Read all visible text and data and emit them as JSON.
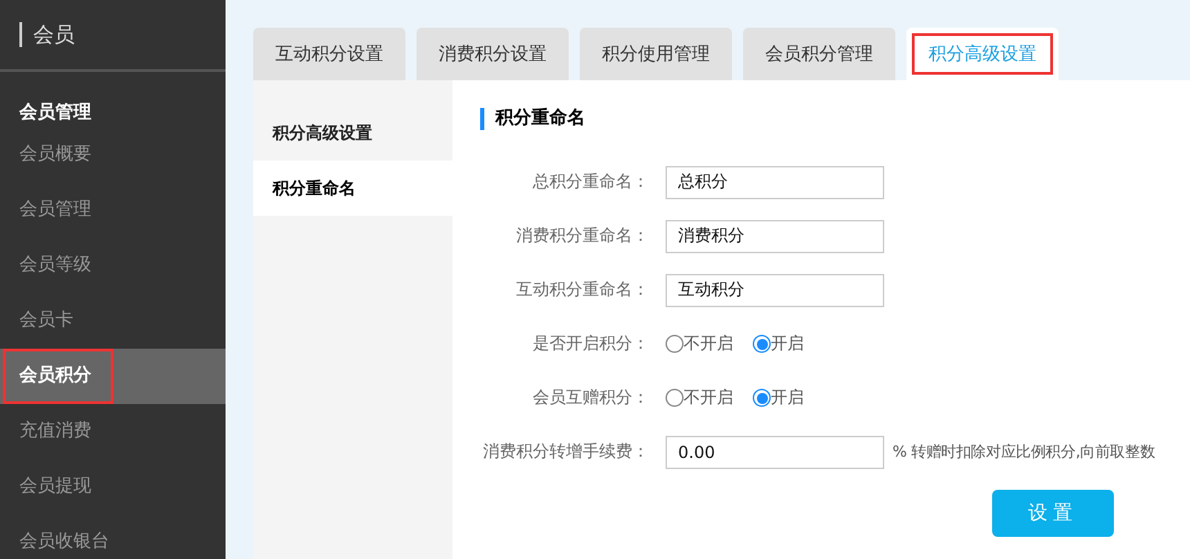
{
  "sidebar": {
    "title": "会员",
    "section": "会员管理",
    "items": [
      {
        "label": "会员概要",
        "selected": false
      },
      {
        "label": "会员管理",
        "selected": false
      },
      {
        "label": "会员等级",
        "selected": false
      },
      {
        "label": "会员卡",
        "selected": false
      },
      {
        "label": "会员积分",
        "selected": true
      },
      {
        "label": "充值消费",
        "selected": false
      },
      {
        "label": "会员提现",
        "selected": false
      },
      {
        "label": "会员收银台",
        "selected": false
      }
    ]
  },
  "tabs": [
    {
      "label": "互动积分设置",
      "selected": false
    },
    {
      "label": "消费积分设置",
      "selected": false
    },
    {
      "label": "积分使用管理",
      "selected": false
    },
    {
      "label": "会员积分管理",
      "selected": false
    },
    {
      "label": "积分高级设置",
      "selected": true
    }
  ],
  "subnav": [
    {
      "label": "积分高级设置",
      "selected": false
    },
    {
      "label": "积分重命名",
      "selected": true
    }
  ],
  "form": {
    "title": "积分重命名",
    "rows": [
      {
        "kind": "text",
        "label": "总积分重命名：",
        "value": "总积分"
      },
      {
        "kind": "text",
        "label": "消费积分重命名：",
        "value": "消费积分"
      },
      {
        "kind": "text",
        "label": "互动积分重命名：",
        "value": "互动积分"
      },
      {
        "kind": "radio",
        "label": "是否开启积分：",
        "options": [
          {
            "label": "不开启",
            "selected": false
          },
          {
            "label": "开启",
            "selected": true
          }
        ]
      },
      {
        "kind": "radio",
        "label": "会员互赠积分：",
        "options": [
          {
            "label": "不开启",
            "selected": false
          },
          {
            "label": "开启",
            "selected": true
          }
        ]
      },
      {
        "kind": "text",
        "label": "消费积分转增手续费：",
        "value": "0.00",
        "note": "% 转赠时扣除对应比例积分,向前取整数"
      }
    ],
    "submit": "设置"
  }
}
